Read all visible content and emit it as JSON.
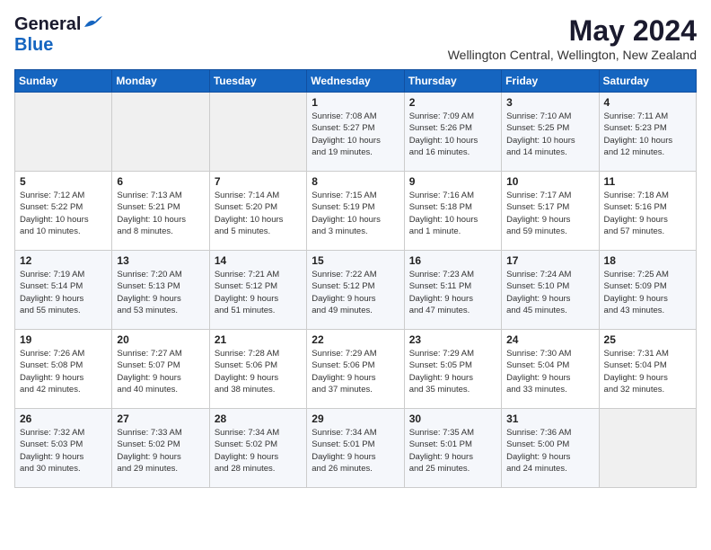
{
  "header": {
    "logo_line1": "General",
    "logo_line2": "Blue",
    "month_title": "May 2024",
    "subtitle": "Wellington Central, Wellington, New Zealand"
  },
  "days_of_week": [
    "Sunday",
    "Monday",
    "Tuesday",
    "Wednesday",
    "Thursday",
    "Friday",
    "Saturday"
  ],
  "weeks": [
    [
      {
        "day": "",
        "info": ""
      },
      {
        "day": "",
        "info": ""
      },
      {
        "day": "",
        "info": ""
      },
      {
        "day": "1",
        "info": "Sunrise: 7:08 AM\nSunset: 5:27 PM\nDaylight: 10 hours\nand 19 minutes."
      },
      {
        "day": "2",
        "info": "Sunrise: 7:09 AM\nSunset: 5:26 PM\nDaylight: 10 hours\nand 16 minutes."
      },
      {
        "day": "3",
        "info": "Sunrise: 7:10 AM\nSunset: 5:25 PM\nDaylight: 10 hours\nand 14 minutes."
      },
      {
        "day": "4",
        "info": "Sunrise: 7:11 AM\nSunset: 5:23 PM\nDaylight: 10 hours\nand 12 minutes."
      }
    ],
    [
      {
        "day": "5",
        "info": "Sunrise: 7:12 AM\nSunset: 5:22 PM\nDaylight: 10 hours\nand 10 minutes."
      },
      {
        "day": "6",
        "info": "Sunrise: 7:13 AM\nSunset: 5:21 PM\nDaylight: 10 hours\nand 8 minutes."
      },
      {
        "day": "7",
        "info": "Sunrise: 7:14 AM\nSunset: 5:20 PM\nDaylight: 10 hours\nand 5 minutes."
      },
      {
        "day": "8",
        "info": "Sunrise: 7:15 AM\nSunset: 5:19 PM\nDaylight: 10 hours\nand 3 minutes."
      },
      {
        "day": "9",
        "info": "Sunrise: 7:16 AM\nSunset: 5:18 PM\nDaylight: 10 hours\nand 1 minute."
      },
      {
        "day": "10",
        "info": "Sunrise: 7:17 AM\nSunset: 5:17 PM\nDaylight: 9 hours\nand 59 minutes."
      },
      {
        "day": "11",
        "info": "Sunrise: 7:18 AM\nSunset: 5:16 PM\nDaylight: 9 hours\nand 57 minutes."
      }
    ],
    [
      {
        "day": "12",
        "info": "Sunrise: 7:19 AM\nSunset: 5:14 PM\nDaylight: 9 hours\nand 55 minutes."
      },
      {
        "day": "13",
        "info": "Sunrise: 7:20 AM\nSunset: 5:13 PM\nDaylight: 9 hours\nand 53 minutes."
      },
      {
        "day": "14",
        "info": "Sunrise: 7:21 AM\nSunset: 5:12 PM\nDaylight: 9 hours\nand 51 minutes."
      },
      {
        "day": "15",
        "info": "Sunrise: 7:22 AM\nSunset: 5:12 PM\nDaylight: 9 hours\nand 49 minutes."
      },
      {
        "day": "16",
        "info": "Sunrise: 7:23 AM\nSunset: 5:11 PM\nDaylight: 9 hours\nand 47 minutes."
      },
      {
        "day": "17",
        "info": "Sunrise: 7:24 AM\nSunset: 5:10 PM\nDaylight: 9 hours\nand 45 minutes."
      },
      {
        "day": "18",
        "info": "Sunrise: 7:25 AM\nSunset: 5:09 PM\nDaylight: 9 hours\nand 43 minutes."
      }
    ],
    [
      {
        "day": "19",
        "info": "Sunrise: 7:26 AM\nSunset: 5:08 PM\nDaylight: 9 hours\nand 42 minutes."
      },
      {
        "day": "20",
        "info": "Sunrise: 7:27 AM\nSunset: 5:07 PM\nDaylight: 9 hours\nand 40 minutes."
      },
      {
        "day": "21",
        "info": "Sunrise: 7:28 AM\nSunset: 5:06 PM\nDaylight: 9 hours\nand 38 minutes."
      },
      {
        "day": "22",
        "info": "Sunrise: 7:29 AM\nSunset: 5:06 PM\nDaylight: 9 hours\nand 37 minutes."
      },
      {
        "day": "23",
        "info": "Sunrise: 7:29 AM\nSunset: 5:05 PM\nDaylight: 9 hours\nand 35 minutes."
      },
      {
        "day": "24",
        "info": "Sunrise: 7:30 AM\nSunset: 5:04 PM\nDaylight: 9 hours\nand 33 minutes."
      },
      {
        "day": "25",
        "info": "Sunrise: 7:31 AM\nSunset: 5:04 PM\nDaylight: 9 hours\nand 32 minutes."
      }
    ],
    [
      {
        "day": "26",
        "info": "Sunrise: 7:32 AM\nSunset: 5:03 PM\nDaylight: 9 hours\nand 30 minutes."
      },
      {
        "day": "27",
        "info": "Sunrise: 7:33 AM\nSunset: 5:02 PM\nDaylight: 9 hours\nand 29 minutes."
      },
      {
        "day": "28",
        "info": "Sunrise: 7:34 AM\nSunset: 5:02 PM\nDaylight: 9 hours\nand 28 minutes."
      },
      {
        "day": "29",
        "info": "Sunrise: 7:34 AM\nSunset: 5:01 PM\nDaylight: 9 hours\nand 26 minutes."
      },
      {
        "day": "30",
        "info": "Sunrise: 7:35 AM\nSunset: 5:01 PM\nDaylight: 9 hours\nand 25 minutes."
      },
      {
        "day": "31",
        "info": "Sunrise: 7:36 AM\nSunset: 5:00 PM\nDaylight: 9 hours\nand 24 minutes."
      },
      {
        "day": "",
        "info": ""
      }
    ]
  ]
}
